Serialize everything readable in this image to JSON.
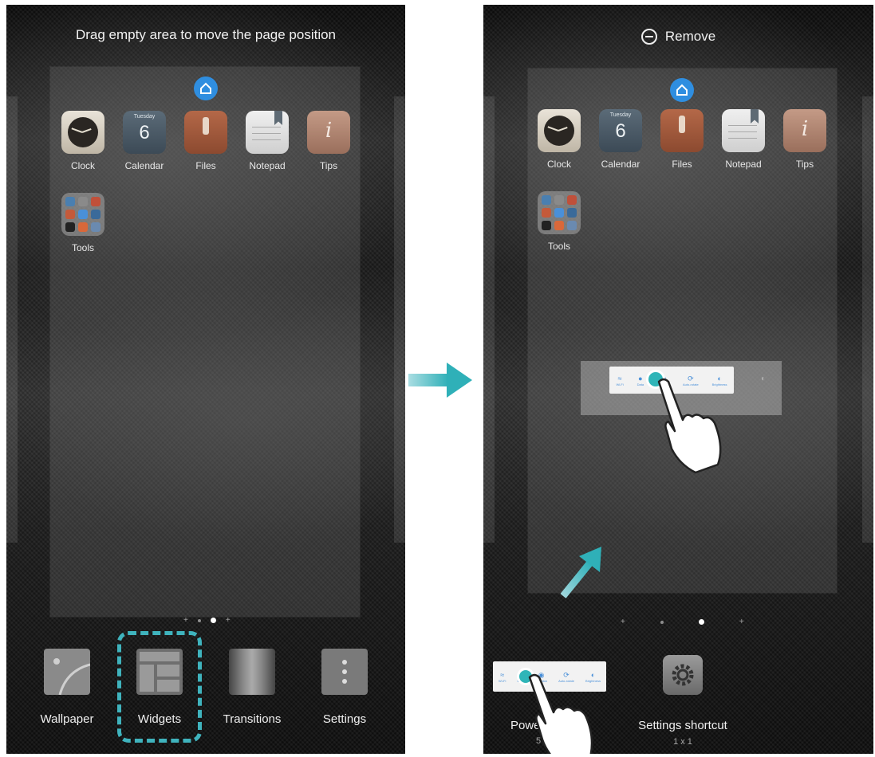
{
  "left_screen": {
    "hint": "Drag empty area to move the page position",
    "apps": [
      {
        "label": "Clock",
        "icon": "clock-icon"
      },
      {
        "label": "Calendar",
        "icon": "calendar-icon",
        "day": "Tuesday",
        "date": "6"
      },
      {
        "label": "Files",
        "icon": "files-icon"
      },
      {
        "label": "Notepad",
        "icon": "notepad-icon"
      },
      {
        "label": "Tips",
        "icon": "tips-icon"
      }
    ],
    "folder": {
      "label": "Tools",
      "icon": "folder-icon"
    },
    "page_indicator": {
      "pages": 4,
      "current": 3
    },
    "toolbar": [
      {
        "label": "Wallpaper",
        "icon": "wallpaper-icon"
      },
      {
        "label": "Widgets",
        "icon": "widgets-icon",
        "highlighted": true
      },
      {
        "label": "Transitions",
        "icon": "transitions-icon"
      },
      {
        "label": "Settings",
        "icon": "settings-dots-icon"
      }
    ]
  },
  "right_screen": {
    "remove_label": "Remove",
    "apps": [
      {
        "label": "Clock",
        "icon": "clock-icon"
      },
      {
        "label": "Calendar",
        "icon": "calendar-icon",
        "day": "Tuesday",
        "date": "6"
      },
      {
        "label": "Files",
        "icon": "files-icon"
      },
      {
        "label": "Notepad",
        "icon": "notepad-icon"
      },
      {
        "label": "Tips",
        "icon": "tips-icon"
      }
    ],
    "folder": {
      "label": "Tools",
      "icon": "folder-icon"
    },
    "page_indicator": {
      "pages": 4,
      "current": 3
    },
    "widget_options": [
      {
        "label": "Powe",
        "size": "5 x",
        "icon": "power-widget-icon"
      },
      {
        "label": "Settings shortcut",
        "size": "1 x 1",
        "icon": "gear-icon"
      }
    ]
  },
  "colors": {
    "accent": "#3fb3bd",
    "home_badge": "#2f8ee0",
    "widget_glyph": "#4a90d9"
  }
}
